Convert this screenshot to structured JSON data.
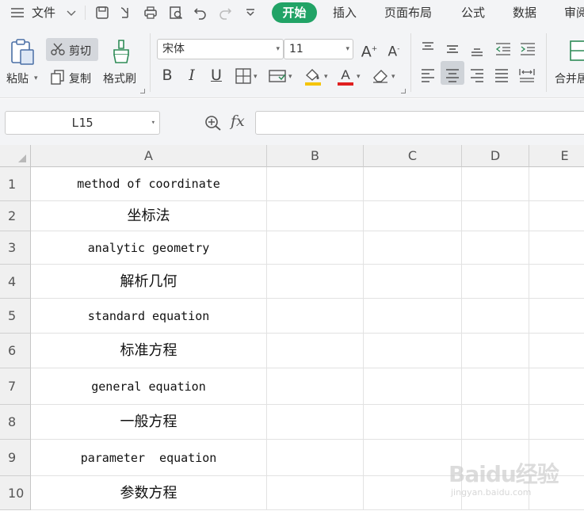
{
  "menu": {
    "file_label": "文件",
    "tabs": [
      "开始",
      "插入",
      "页面布局",
      "公式",
      "数据",
      "审阅"
    ],
    "active_tab": "开始"
  },
  "ribbon": {
    "paste_label": "粘贴",
    "cut_label": "剪切",
    "copy_label": "复制",
    "format_painter_label": "格式刷",
    "font_name": "宋体",
    "font_size": "11",
    "merge_label": "合并居中",
    "bold": "B",
    "italic": "I",
    "underline": "U",
    "font_color": "#e02020",
    "fill_color": "#f5c400"
  },
  "formula_bar": {
    "cell_ref": "L15",
    "fx_label": "fx",
    "content": ""
  },
  "sheet": {
    "columns": [
      "A",
      "B",
      "C",
      "D",
      "E"
    ],
    "rows": [
      {
        "num": "1",
        "value": "method of coordinate",
        "lang": "en"
      },
      {
        "num": "2",
        "value": "坐标法",
        "lang": "zh"
      },
      {
        "num": "3",
        "value": "analytic geometry",
        "lang": "en"
      },
      {
        "num": "4",
        "value": "解析几何",
        "lang": "zh"
      },
      {
        "num": "5",
        "value": "standard equation",
        "lang": "en"
      },
      {
        "num": "6",
        "value": "标准方程",
        "lang": "zh"
      },
      {
        "num": "7",
        "value": "general equation",
        "lang": "en"
      },
      {
        "num": "8",
        "value": "一般方程",
        "lang": "zh"
      },
      {
        "num": "9",
        "value": "parameter  equation",
        "lang": "en"
      },
      {
        "num": "10",
        "value": "参数方程",
        "lang": "zh"
      }
    ]
  },
  "watermark": {
    "logo": "Baidu经验",
    "url": "jingyan.baidu.com"
  },
  "colors": {
    "accent": "#21a366",
    "toolbar_bg": "#f3f4f6",
    "header_bg": "#f0f0f0"
  }
}
